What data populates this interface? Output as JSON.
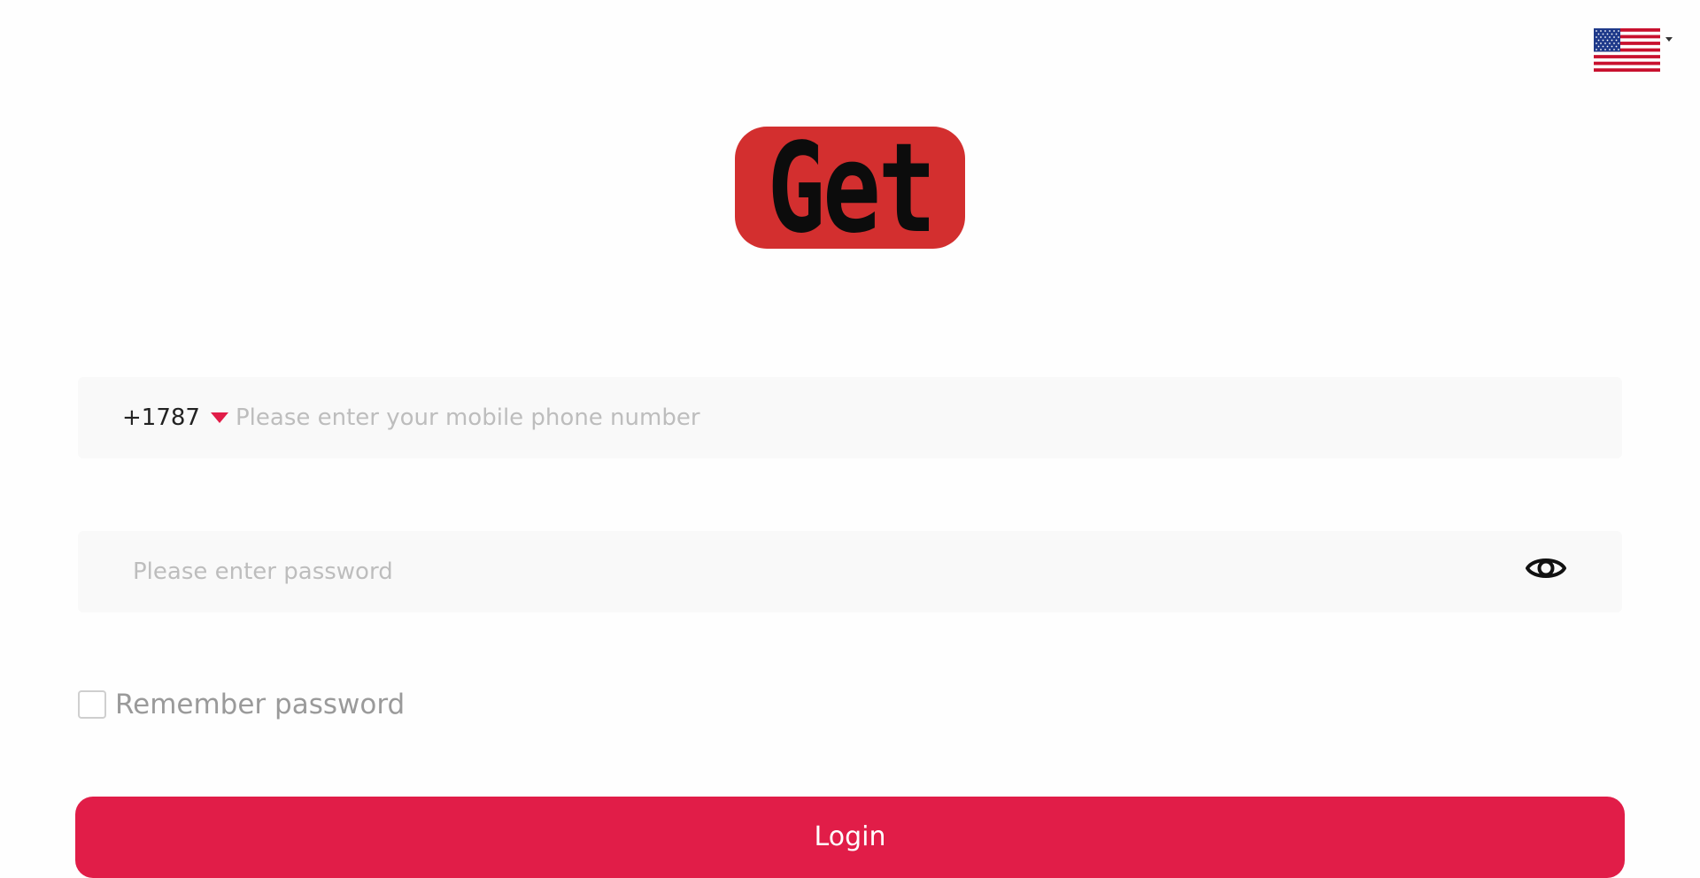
{
  "language": {
    "flag_icon": "us-flag-icon",
    "caret_icon": "caret-down-icon"
  },
  "logo": {
    "text": "Get",
    "background_color": "#d32f2f"
  },
  "phone": {
    "country_code": "+1787",
    "placeholder": "Please enter your mobile phone number",
    "caret_color": "#e11d48"
  },
  "password": {
    "placeholder": "Please enter password",
    "toggle_icon": "eye-icon"
  },
  "remember": {
    "label": "Remember password",
    "checked": false
  },
  "login": {
    "label": "Login",
    "color": "#e11d48"
  }
}
